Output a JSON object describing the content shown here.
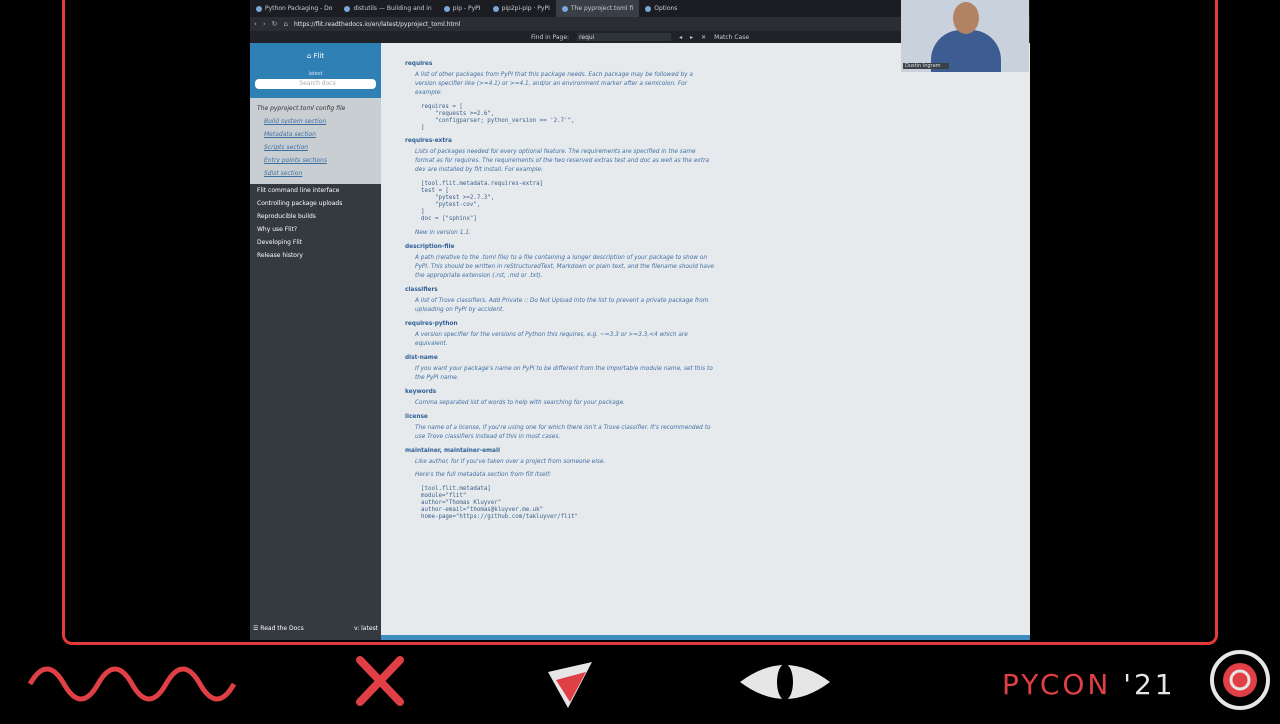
{
  "browser": {
    "tabs": [
      {
        "label": "Python Packaging - Do"
      },
      {
        "label": "distutils — Building and in"
      },
      {
        "label": "pip - PyPI"
      },
      {
        "label": "pip2pi-pip · PyPI"
      },
      {
        "label": "The pyproject.toml fi"
      },
      {
        "label": "Options"
      }
    ],
    "url": "https://flit.readthedocs.io/en/latest/pyproject_toml.html",
    "find": {
      "label": "Find in Page:",
      "value": "requi",
      "match_case": "Match Case"
    }
  },
  "sidebar": {
    "brand": "Flit",
    "version": "latest",
    "search_placeholder": "Search docs",
    "current_section": "The pyproject.toml config file",
    "subsections": [
      "Build system section",
      "Metadata section",
      "Scripts section",
      "Entry points sections",
      "Sdist section"
    ],
    "items": [
      "Flit command line interface",
      "Controlling package uploads",
      "Reproducible builds",
      "Why use Flit?",
      "Developing Flit",
      "Release history"
    ],
    "footer": {
      "left": "Read the Docs",
      "right": "v: latest"
    }
  },
  "doc": {
    "entries": [
      {
        "term": "requires",
        "text": "A list of other packages from PyPI that this package needs. Each package may be followed by a version specifier like (>=4.1) or >=4.1, and/or an environment marker after a semicolon. For example:",
        "code": "requires = [\n    \"requests >=2.6\",\n    \"configparser; python_version == '2.7'\",\n]"
      },
      {
        "term": "requires-extra",
        "text": "Lists of packages needed for every optional feature. The requirements are specified in the same format as for requires. The requirements of the two reserved extras test and doc as well as the extra dev are installed by flit install. For example:",
        "code": "[tool.flit.metadata.requires-extra]\ntest = [\n    \"pytest >=2.7.3\",\n    \"pytest-cov\",\n]\ndoc = [\"sphinx\"]"
      },
      {
        "term": "",
        "text": "New in version 1.1.",
        "code": ""
      },
      {
        "term": "description-file",
        "text": "A path (relative to the .toml file) to a file containing a longer description of your package to show on PyPI. This should be written in reStructuredText, Markdown or plain text, and the filename should have the appropriate extension (.rst, .md or .txt).",
        "code": ""
      },
      {
        "term": "classifiers",
        "text": "A list of Trove classifiers. Add Private :: Do Not Upload into the list to prevent a private package from uploading on PyPI by accident.",
        "code": ""
      },
      {
        "term": "requires-python",
        "text": "A version specifier for the versions of Python this requires, e.g. ~=3.3 or >=3.3,<4 which are equivalent.",
        "code": ""
      },
      {
        "term": "dist-name",
        "text": "If you want your package's name on PyPI to be different from the importable module name, set this to the PyPI name.",
        "code": ""
      },
      {
        "term": "keywords",
        "text": "Comma separated list of words to help with searching for your package.",
        "code": ""
      },
      {
        "term": "license",
        "text": "The name of a license, if you're using one for which there isn't a Trove classifier. It's recommended to use Trove classifiers instead of this in most cases.",
        "code": ""
      },
      {
        "term": "maintainer, maintainer-email",
        "text": "Like author, for if you've taken over a project from someone else.",
        "code": ""
      },
      {
        "term": "",
        "text": "Here's the full metadata section from flit itself:",
        "code": "[tool.flit.metadata]\nmodule=\"flit\"\nauthor=\"Thomas Kluyver\"\nauthor-email=\"thomas@kluyver.me.uk\"\nhome-page=\"https://github.com/takluyver/flit\""
      }
    ]
  },
  "webcam": {
    "caption": "Dustin Ingram"
  },
  "footer": {
    "brand": "PYCON",
    "year": "'21"
  },
  "colors": {
    "accent": "#e23a3d",
    "sidebar": "#343a40",
    "sidebar_head": "#2f80b5",
    "highlight": "#ff5f6b"
  }
}
